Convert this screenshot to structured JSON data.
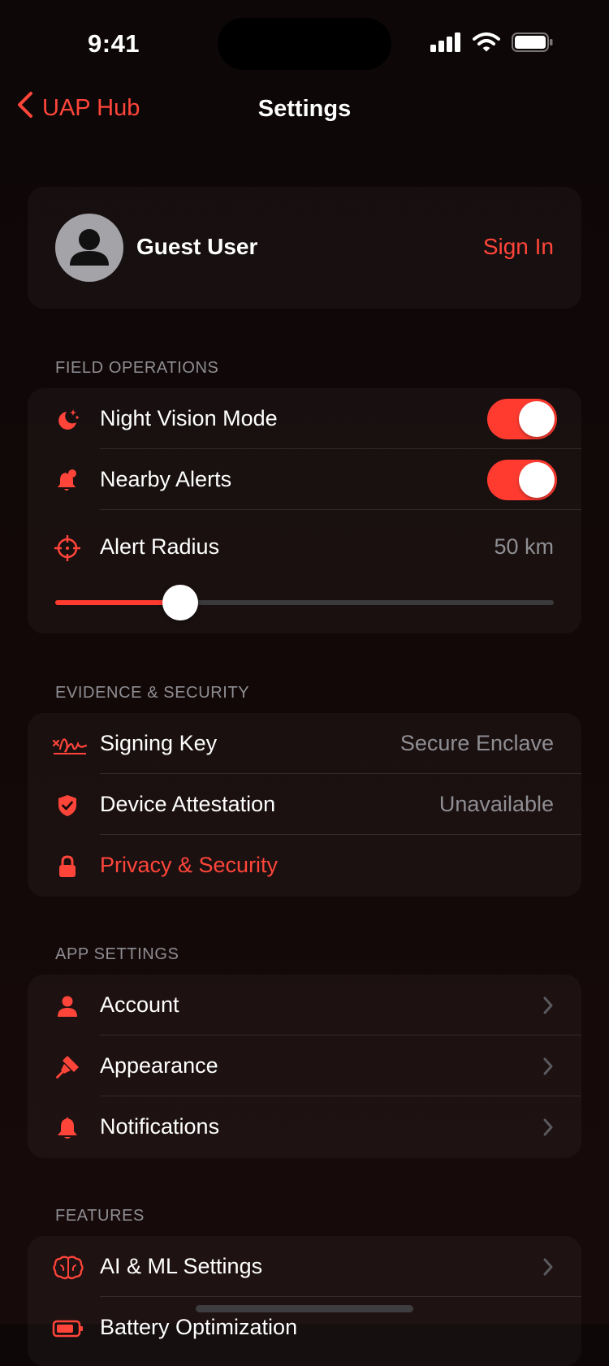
{
  "status": {
    "time": "9:41"
  },
  "nav": {
    "back_label": "UAP Hub",
    "title": "Settings"
  },
  "profile": {
    "name": "Guest User",
    "sign_in_label": "Sign In"
  },
  "field_operations": {
    "header": "FIELD OPERATIONS",
    "night_vision": {
      "label": "Night Vision Mode",
      "on": true
    },
    "nearby_alerts": {
      "label": "Nearby Alerts",
      "on": true
    },
    "alert_radius": {
      "label": "Alert Radius",
      "value": "50 km",
      "slider_fraction": 0.25
    }
  },
  "evidence_security": {
    "header": "EVIDENCE & SECURITY",
    "signing_key": {
      "label": "Signing Key",
      "value": "Secure Enclave"
    },
    "device_attestation": {
      "label": "Device Attestation",
      "value": "Unavailable"
    },
    "privacy": {
      "label": "Privacy & Security"
    }
  },
  "app_settings": {
    "header": "APP SETTINGS",
    "items": [
      {
        "label": "Account"
      },
      {
        "label": "Appearance"
      },
      {
        "label": "Notifications"
      }
    ]
  },
  "features": {
    "header": "FEATURES",
    "items": [
      {
        "label": "AI & ML Settings"
      },
      {
        "label": "Battery Optimization"
      }
    ]
  },
  "colors": {
    "accent": "#ff453a",
    "toggle_on": "#ff3b30",
    "secondary_text": "#8e8e93"
  }
}
